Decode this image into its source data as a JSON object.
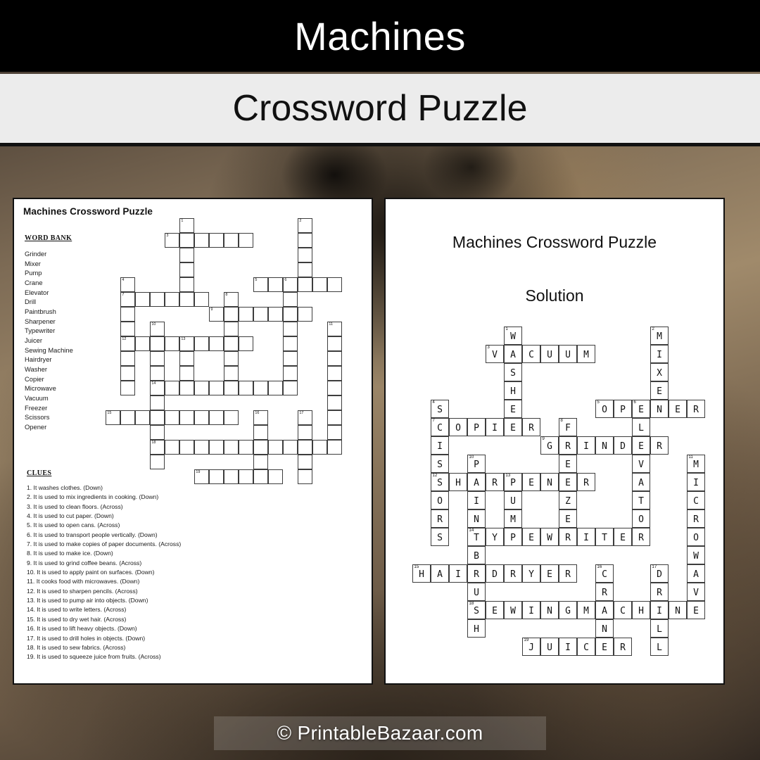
{
  "header": {
    "topic_title": "Machines",
    "subtitle": "Crossword Puzzle"
  },
  "worksheet": {
    "title": "Machines Crossword Puzzle",
    "word_bank_heading": "WORD BANK",
    "word_bank": [
      "Grinder",
      "Mixer",
      "Pump",
      "Crane",
      "Elevator",
      "Drill",
      "Paintbrush",
      "Sharpener",
      "Typewriter",
      "Juicer",
      "Sewing Machine",
      "Hairdryer",
      "Washer",
      "Copier",
      "Microwave",
      "Vacuum",
      "Freezer",
      "Scissors",
      "Opener"
    ],
    "clues_heading": "CLUES",
    "clues": [
      "1. It washes clothes. (Down)",
      "2. It is used to mix ingredients in cooking. (Down)",
      "3. It is used to clean floors. (Across)",
      "4. It is used to cut paper. (Down)",
      "5. It is used to open cans. (Across)",
      "6. It is used to transport people vertically. (Down)",
      "7. It is used to make copies of paper documents.  (Across)",
      "8. It is used to make ice. (Down)",
      "9. It is used to grind coffee beans. (Across)",
      "10. It is used to apply paint on surfaces. (Down)",
      "11. It cooks food with microwaves. (Down)",
      "12. It is used to sharpen pencils. (Across)",
      "13. It is used to pump air into objects. (Down)",
      "14. It is used to write letters. (Across)",
      "15. It is used to dry wet hair. (Across)",
      "16. It is used to lift heavy objects. (Down)",
      "17. It is used to drill holes in objects. (Down)",
      "18. It is used to sew fabrics. (Across)",
      "19. It is used to squeeze juice from  fruits. (Across)"
    ]
  },
  "solution_sheet": {
    "title": "Machines Crossword Puzzle",
    "subtitle": "Solution"
  },
  "footer": {
    "watermark": "© PrintableBazaar.com"
  },
  "chart_data": {
    "type": "table",
    "title": "Machines Crossword Puzzle",
    "cell_size_left": 21,
    "cell_size_right": 26,
    "grid_cols": 16,
    "grid_rows": 18,
    "entries": [
      {
        "number": 1,
        "answer": "WASHER",
        "direction": "Down",
        "clue": "It washes clothes.",
        "row": 0,
        "col": 5
      },
      {
        "number": 2,
        "answer": "MIXER",
        "direction": "Down",
        "clue": "It is used to mix ingredients in cooking.",
        "row": 0,
        "col": 13
      },
      {
        "number": 3,
        "answer": "VACUUM",
        "direction": "Across",
        "clue": "It is used to clean floors.",
        "row": 1,
        "col": 4
      },
      {
        "number": 4,
        "answer": "SCISSORS",
        "direction": "Down",
        "clue": "It is used to cut paper.",
        "row": 4,
        "col": 1
      },
      {
        "number": 5,
        "answer": "OPENER",
        "direction": "Across",
        "clue": "It is used to open cans.",
        "row": 4,
        "col": 10
      },
      {
        "number": 6,
        "answer": "ELEVATOR",
        "direction": "Down",
        "clue": "It is used to transport people vertically.",
        "row": 4,
        "col": 12
      },
      {
        "number": 7,
        "answer": "COPIER",
        "direction": "Across",
        "clue": "It is used to make copies of paper documents.",
        "row": 5,
        "col": 1
      },
      {
        "number": 8,
        "answer": "FREEZER",
        "direction": "Down",
        "clue": "It is used to make ice.",
        "row": 5,
        "col": 8
      },
      {
        "number": 9,
        "answer": "GRINDER",
        "direction": "Across",
        "clue": "It is used to grind coffee beans.",
        "row": 6,
        "col": 7
      },
      {
        "number": 10,
        "answer": "PAINTBRUSH",
        "direction": "Down",
        "clue": "It is used to apply paint on surfaces.",
        "row": 7,
        "col": 3
      },
      {
        "number": 11,
        "answer": "MICROWAVE",
        "direction": "Down",
        "clue": "It cooks food with microwaves.",
        "row": 7,
        "col": 15
      },
      {
        "number": 12,
        "answer": "SHARPENER",
        "direction": "Across",
        "clue": "It is used to sharpen pencils.",
        "row": 8,
        "col": 1
      },
      {
        "number": 13,
        "answer": "PUMP",
        "direction": "Down",
        "clue": "It is used to pump air into objects.",
        "row": 8,
        "col": 5
      },
      {
        "number": 14,
        "answer": "TYPEWRITER",
        "direction": "Across",
        "clue": "It is used to write letters.",
        "row": 11,
        "col": 3
      },
      {
        "number": 15,
        "answer": "HAIRDRYER",
        "direction": "Across",
        "clue": "It is used to dry wet hair.",
        "row": 13,
        "col": 0
      },
      {
        "number": 16,
        "answer": "CRANE",
        "direction": "Down",
        "clue": "It is used to lift heavy objects.",
        "row": 13,
        "col": 10
      },
      {
        "number": 17,
        "answer": "DRILL",
        "direction": "Down",
        "clue": "It is used to drill holes in objects.",
        "row": 13,
        "col": 13
      },
      {
        "number": 18,
        "answer": "SEWINGMACHINE",
        "direction": "Across",
        "clue": "It is used to sew fabrics.",
        "row": 15,
        "col": 3
      },
      {
        "number": 19,
        "answer": "JUICER",
        "direction": "Across",
        "clue": "It is used to squeeze juice from fruits.",
        "row": 17,
        "col": 6
      }
    ]
  }
}
